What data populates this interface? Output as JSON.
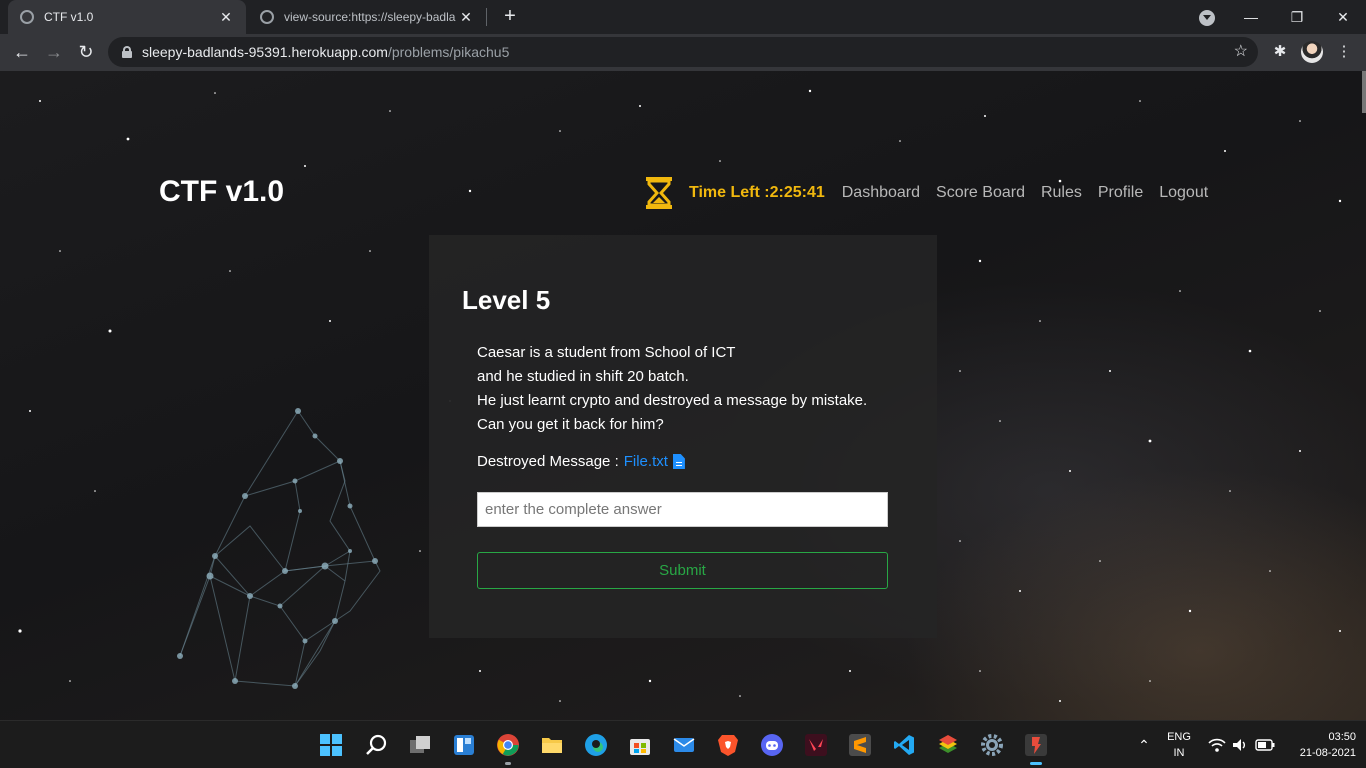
{
  "browser": {
    "tabs": [
      {
        "title": "CTF v1.0",
        "active": true
      },
      {
        "title": "view-source:https://sleepy-badla",
        "active": false
      }
    ],
    "url_host": "sleepy-badlands-95391.herokuapp.com",
    "url_path": "/problems/pikachu5"
  },
  "site": {
    "brand": "CTF v1.0",
    "timer": "Time Left :2:25:41",
    "nav": [
      "Dashboard",
      "Score Board",
      "Rules",
      "Profile",
      "Logout"
    ]
  },
  "problem": {
    "title": "Level 5",
    "description": [
      "Caesar is a student from School of ICT",
      "and he studied in shift 20 batch.",
      "He just learnt crypto and destroyed a message by mistake.",
      "Can you get it back for him?"
    ],
    "message_label": "Destroyed Message :",
    "file_link": "File.txt",
    "answer_placeholder": "enter the complete answer",
    "submit_label": "Submit"
  },
  "taskbar": {
    "language": "ENG",
    "region": "IN",
    "time": "03:50",
    "date": "21-08-2021"
  },
  "colors": {
    "timer": "#f1b80e",
    "link": "#1e90ff",
    "submit": "#28a745"
  }
}
